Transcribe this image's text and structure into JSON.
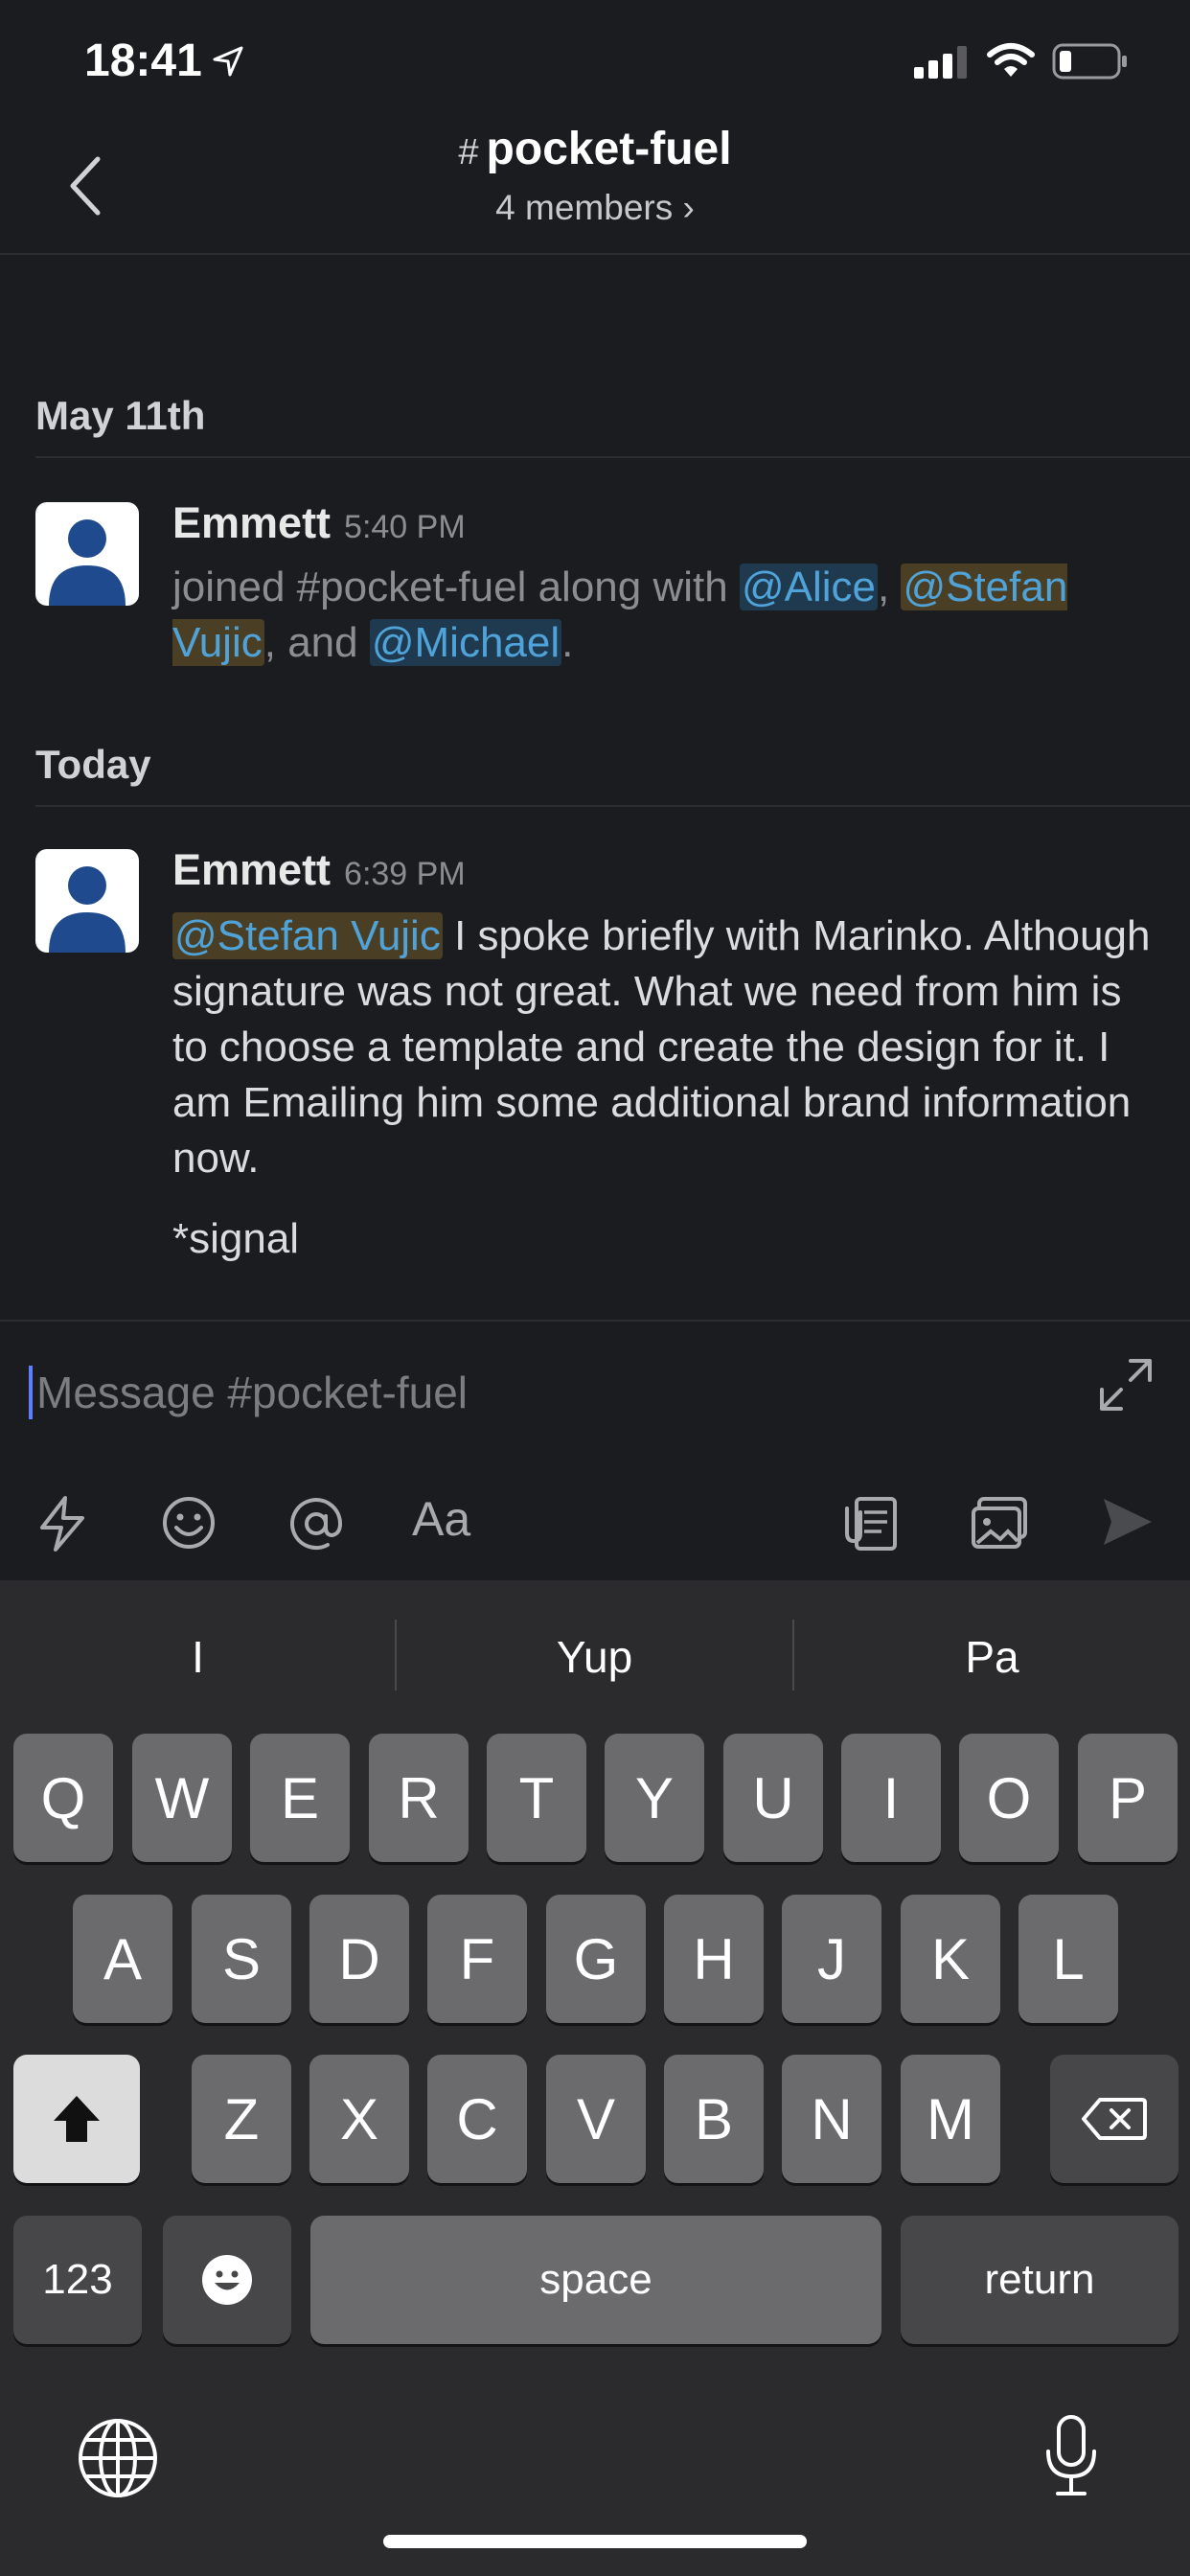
{
  "status_bar": {
    "time": "18:41"
  },
  "header": {
    "hash": "#",
    "channel_name": "pocket-fuel",
    "members": "4 members ›"
  },
  "feed": {
    "days": [
      {
        "date": "May 11th",
        "message": {
          "author": "Emmett",
          "time": "5:40 PM",
          "text_before": "joined #pocket-fuel along with ",
          "mention1": "@Alice",
          "comma1": ", ",
          "mention2": "@Stefan Vujic",
          "comma2": ", and ",
          "mention3": "@Michael",
          "period": "."
        }
      },
      {
        "date": "Today",
        "message": {
          "author": "Emmett",
          "time": "6:39 PM",
          "mention": "@Stefan Vujic",
          "text": " I spoke briefly with Marinko. Although signature was not great. What we need from him is to choose a template and create the design for it. I am Emailing him some additional brand information now.",
          "followup": "*signal"
        }
      }
    ]
  },
  "composer": {
    "placeholder": "Message #pocket-fuel",
    "format_label": "Aa"
  },
  "keyboard": {
    "suggestions": [
      "I",
      "Yup",
      "Pa"
    ],
    "row1": [
      "Q",
      "W",
      "E",
      "R",
      "T",
      "Y",
      "U",
      "I",
      "O",
      "P"
    ],
    "row2": [
      "A",
      "S",
      "D",
      "F",
      "G",
      "H",
      "J",
      "K",
      "L"
    ],
    "row3": [
      "Z",
      "X",
      "C",
      "V",
      "B",
      "N",
      "M"
    ],
    "numbers_label": "123",
    "space_label": "space",
    "return_label": "return"
  },
  "colors": {
    "background": "#1b1c20",
    "mention_text": "#4fa3d9",
    "keyboard_bg": "#2b2b2d",
    "cursor": "#5b7fff"
  }
}
